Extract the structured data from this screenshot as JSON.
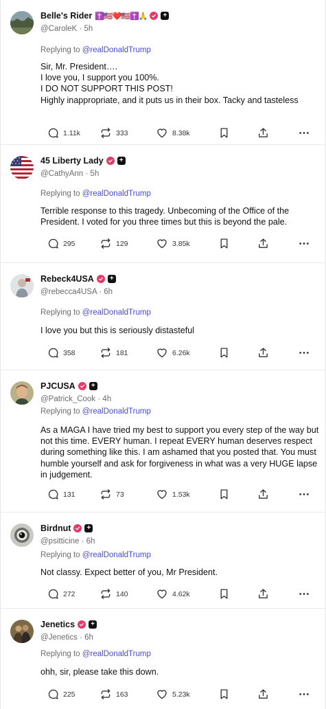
{
  "reply_prefix": "Replying to",
  "reply_mention": "@realDonaldTrump",
  "colors": {
    "verified": "#e5396a",
    "mention": "#4a4ad0",
    "muted": "#6b6b6b"
  },
  "posts": [
    {
      "display_name": "Belle's Rider",
      "emoji": "✝️🇺🇸❤️🇺🇸✝️🙏",
      "handle": "@CaroleK",
      "time": "5h",
      "text": "Sir, Mr. President….\nI love you, I support you 100%.\nI DO NOT SUPPORT THIS POST!\nHighly inappropriate, and it puts us in their box. Tacky and tasteless",
      "replies": "1.11k",
      "reposts": "333",
      "likes": "8.38k",
      "avatar": "landscape"
    },
    {
      "display_name": "45 Liberty Lady",
      "emoji": "",
      "handle": "@CathyAnn",
      "time": "5h",
      "text": "Terrible response to this tragedy.  Unbecoming of the Office of the President.  I voted for you three times but this is beyond the pale.",
      "replies": "295",
      "reposts": "129",
      "likes": "3.85k",
      "avatar": "flag"
    },
    {
      "display_name": "Rebeck4USA",
      "emoji": "",
      "handle": "@rebecca4USA",
      "time": "6h",
      "text": "I love you but this is seriously distasteful",
      "replies": "358",
      "reposts": "181",
      "likes": "6.26k",
      "avatar": "person-light"
    },
    {
      "display_name": "PJCUSA",
      "emoji": "",
      "handle": "@Patrick_Cook",
      "time": "4h",
      "text": "As a MAGA I have tried my best to support you every step of the way but not this time.  EVERY human.  I repeat EVERY human deserves respect during something like this.  I am ashamed that you posted that. You must humble yourself and ask for forgiveness in what was a very HUGE lapse in judgement.",
      "replies": "131",
      "reposts": "73",
      "likes": "1.53k",
      "avatar": "person-face"
    },
    {
      "display_name": "Birdnut",
      "emoji": "",
      "handle": "@psitticine",
      "time": "6h",
      "text": "Not classy. Expect better of you, Mr President.",
      "replies": "272",
      "reposts": "140",
      "likes": "4.62k",
      "avatar": "bird-eye"
    },
    {
      "display_name": "Jenetics",
      "emoji": "",
      "handle": "@Jenetics",
      "time": "6h",
      "text": "ohh, sir, please take this down.",
      "replies": "225",
      "reposts": "163",
      "likes": "5.23k",
      "avatar": "couple"
    }
  ]
}
